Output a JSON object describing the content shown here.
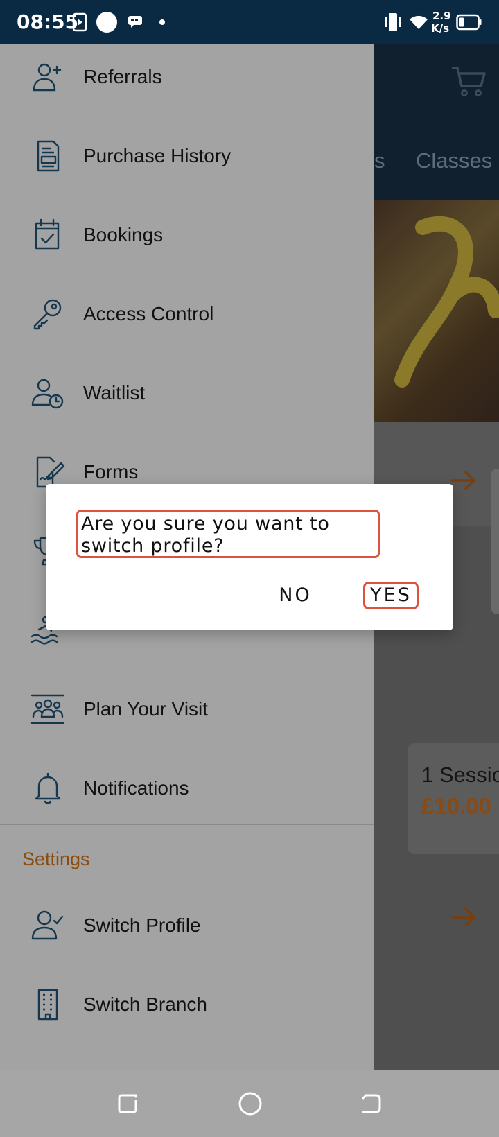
{
  "status_bar": {
    "time": "08:55",
    "speed_value": "2.9",
    "speed_unit": "K/s"
  },
  "background": {
    "tab_partial": "s",
    "tab_classes": "Classes",
    "price_card": {
      "title": "1 Sessio",
      "price": "£10.00"
    }
  },
  "drawer": {
    "items": [
      {
        "label": "Referrals",
        "icon": "user-plus-icon"
      },
      {
        "label": "Purchase History",
        "icon": "receipt-icon"
      },
      {
        "label": "Bookings",
        "icon": "calendar-check-icon"
      },
      {
        "label": "Access Control",
        "icon": "key-icon"
      },
      {
        "label": "Waitlist",
        "icon": "user-clock-icon"
      },
      {
        "label": "Forms",
        "icon": "form-sign-icon"
      },
      {
        "label": "",
        "icon": "trophy-icon"
      },
      {
        "label": "",
        "icon": "swimming-icon"
      },
      {
        "label": "Plan Your Visit",
        "icon": "group-icon"
      },
      {
        "label": "Notifications",
        "icon": "bell-icon"
      }
    ],
    "settings_title": "Settings",
    "settings_items": [
      {
        "label": "Switch Profile",
        "icon": "user-check-icon"
      },
      {
        "label": "Switch Branch",
        "icon": "building-icon"
      }
    ]
  },
  "dialog": {
    "message": "Are you sure you want to switch profile?",
    "no_label": "NO",
    "yes_label": "YES"
  },
  "colors": {
    "accent": "#8a4c0c",
    "highlight": "#d9533f",
    "status_bar": "#0a2a44",
    "icon": "#16384e"
  }
}
